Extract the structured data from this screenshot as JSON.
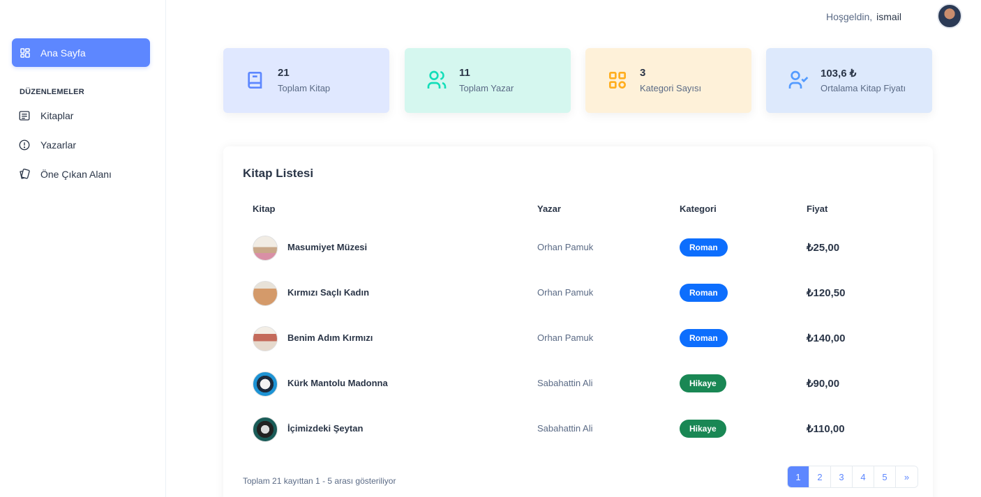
{
  "sidebar": {
    "home_label": "Ana Sayfa",
    "section_title": "DÜZENLEMELER",
    "items": [
      {
        "label": "Kitaplar",
        "icon": "list-icon"
      },
      {
        "label": "Yazarlar",
        "icon": "alert-circle-icon"
      },
      {
        "label": "Öne Çıkan Alanı",
        "icon": "cards-icon"
      }
    ]
  },
  "topbar": {
    "greeting": "Hoşgeldin,",
    "username": "ismail"
  },
  "stats": [
    {
      "value": "21",
      "label": "Toplam Kitap",
      "bg": "#e0e8ff",
      "color": "#5d87ff",
      "icon": "book-icon"
    },
    {
      "value": "11",
      "label": "Toplam Yazar",
      "bg": "#d5f7ef",
      "color": "#13deb9",
      "icon": "users-icon"
    },
    {
      "value": "3",
      "label": "Kategori Sayısı",
      "bg": "#fef1d9",
      "color": "#ffae1f",
      "icon": "category-icon"
    },
    {
      "value": "103,6 ₺",
      "label": "Ortalama Kitap Fiyatı",
      "bg": "#dde9fc",
      "color": "#539bff",
      "icon": "user-check-icon"
    }
  ],
  "table": {
    "title": "Kitap Listesi",
    "headers": [
      "Kitap",
      "Yazar",
      "Kategori",
      "Fiyat"
    ],
    "rows": [
      {
        "book": "Masumiyet Müzesi",
        "author": "Orhan Pamuk",
        "category": "Roman",
        "price": "₺25,00"
      },
      {
        "book": "Kırmızı Saçlı Kadın",
        "author": "Orhan Pamuk",
        "category": "Roman",
        "price": "₺120,50"
      },
      {
        "book": "Benim Adım Kırmızı",
        "author": "Orhan Pamuk",
        "category": "Roman",
        "price": "₺140,00"
      },
      {
        "book": "Kürk Mantolu Madonna",
        "author": "Sabahattin Ali",
        "category": "Hikaye",
        "price": "₺90,00"
      },
      {
        "book": "İçimizdeki Şeytan",
        "author": "Sabahattin Ali",
        "category": "Hikaye",
        "price": "₺110,00"
      }
    ],
    "footer": "Toplam 21 kayıttan 1 - 5 arası gösteriliyor",
    "pages": [
      "1",
      "2",
      "3",
      "4",
      "5",
      "»"
    ],
    "active_page": "1"
  },
  "colors": {
    "accent": "#5d87ff",
    "roman": "#0d6efd",
    "hikaye": "#198754"
  }
}
